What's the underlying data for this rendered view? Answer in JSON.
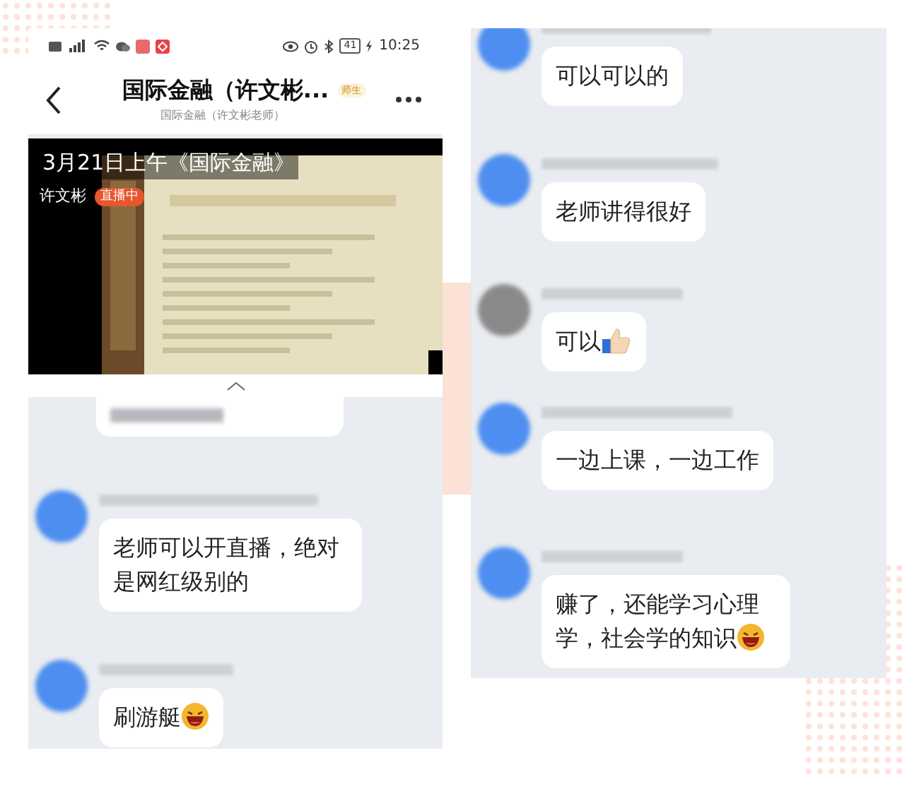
{
  "status_bar": {
    "battery": "41",
    "time": "10:25"
  },
  "header": {
    "title": "国际金融（许文彬...",
    "badge": "师生",
    "subtitle": "国际金融（许文彬老师）"
  },
  "video": {
    "title": "3月21日上午《国际金融》",
    "host": "许文彬",
    "live_badge": "直播中"
  },
  "left_messages": [
    {
      "kind": "blurred"
    },
    {
      "kind": "plain",
      "text": "老师可以开直播，绝对是网红级别的"
    },
    {
      "kind": "laugh",
      "text": "刷游艇"
    }
  ],
  "right_messages": [
    {
      "kind": "plain",
      "text": "可以可以的"
    },
    {
      "kind": "plain",
      "text": "老师讲得很好"
    },
    {
      "kind": "thumbs",
      "text": "可以"
    },
    {
      "kind": "plain",
      "text": "一边上课，一边工作"
    },
    {
      "kind": "laugh",
      "text": "赚了，还能学习心理学，社会学的知识"
    }
  ]
}
